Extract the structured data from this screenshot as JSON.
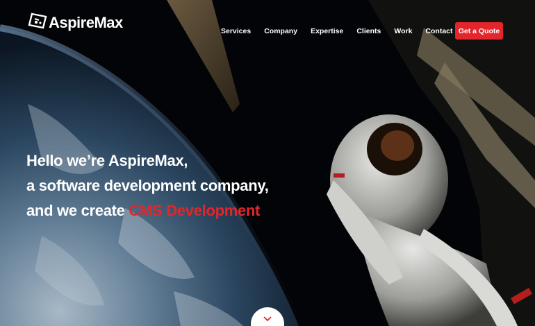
{
  "brand": {
    "name": "AspireMax"
  },
  "nav": {
    "items": [
      {
        "label": "Services"
      },
      {
        "label": "Company"
      },
      {
        "label": "Expertise"
      },
      {
        "label": "Clients"
      },
      {
        "label": "Work"
      },
      {
        "label": "Contact"
      }
    ],
    "cta_label": "Get a Quote"
  },
  "hero": {
    "line1": "Hello we’re AspireMax,",
    "line2": "a software development company,",
    "line3_prefix": "and we create ",
    "line3_highlight": "CMS Development"
  },
  "scroll_button": {
    "icon": "chevron-down-icon"
  },
  "colors": {
    "accent": "#e2262b",
    "text": "#ffffff",
    "background": "#020306"
  }
}
